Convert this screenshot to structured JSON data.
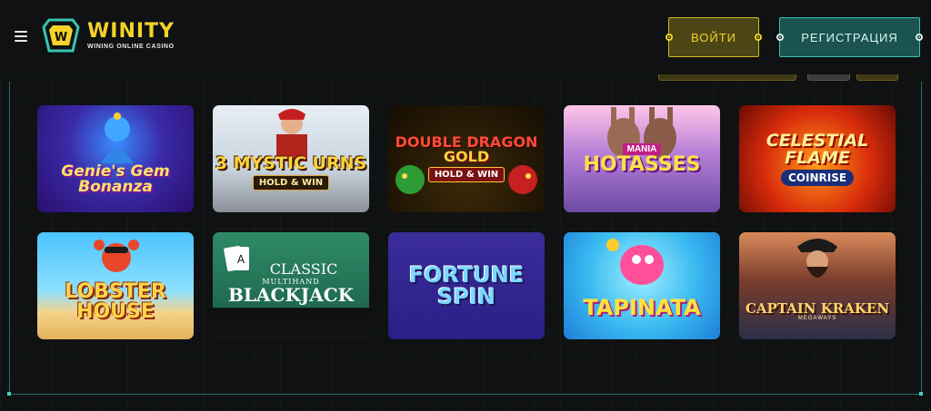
{
  "brand": {
    "name": "WINITY",
    "tagline": "WINING ONLINE CASINO",
    "colors": {
      "accent_yellow": "#f3d229",
      "accent_teal": "#39c2b2",
      "background": "#0f1112"
    }
  },
  "header": {
    "menu_icon": "hamburger-icon",
    "login_label": "ВОЙТИ",
    "register_label": "РЕГИСТРАЦИЯ"
  },
  "games": [
    {
      "id": "genies-gem-bonanza",
      "title": "Genie's Gem Bonanza"
    },
    {
      "id": "3-mystic-urns",
      "title": "3 MYSTIC URNS",
      "subtitle": "HOLD & WIN"
    },
    {
      "id": "double-dragon-gold",
      "title_a": "DOUBLE DRAGON",
      "title_b": "GOLD",
      "subtitle": "HOLD & WIN"
    },
    {
      "id": "mania-hotasses",
      "pre": "MANIA",
      "title": "HOTASSES"
    },
    {
      "id": "celestial-flame",
      "title": "CELESTIAL FLAME",
      "subtitle": "COINRISE"
    },
    {
      "id": "lobster-house",
      "title": "LOBSTER HOUSE"
    },
    {
      "id": "classic-multihand-blackjack",
      "top": "CLASSIC",
      "small": "MULTIHAND",
      "title": "BLACKJACK"
    },
    {
      "id": "fortune-spin",
      "title": "FORTUNE SPIN"
    },
    {
      "id": "tapinata",
      "title": "TAPINATA"
    },
    {
      "id": "captain-kraken",
      "title": "CAPTAIN KRAKEN",
      "small": "MEGAWAYS"
    }
  ]
}
